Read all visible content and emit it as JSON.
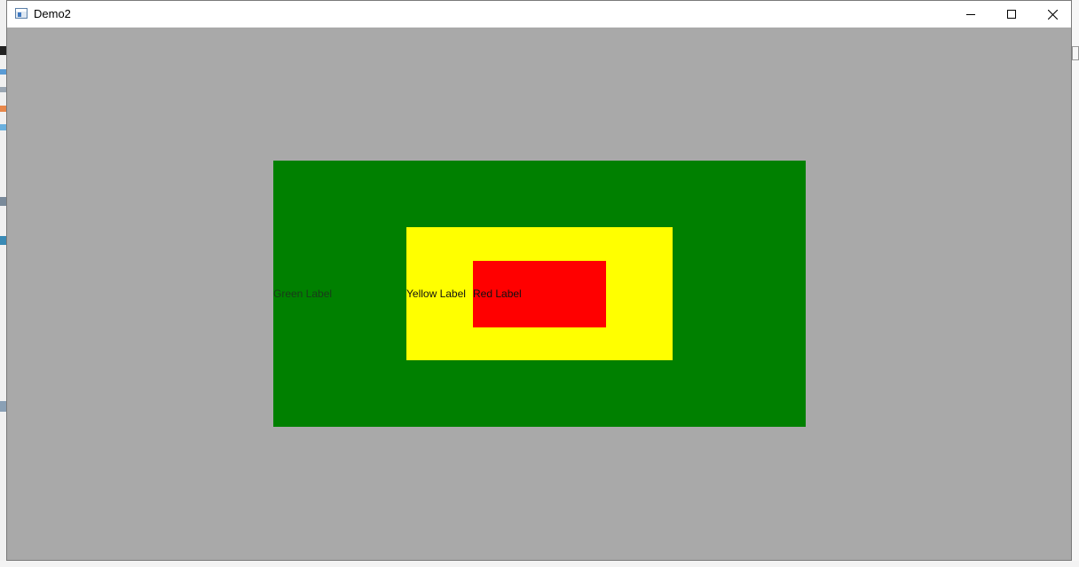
{
  "window": {
    "title": "Demo2",
    "background_color": "#a9a9a9"
  },
  "titlebar": {
    "icon": "app-window-icon",
    "minimize_icon": "minimize-icon",
    "maximize_icon": "maximize-icon",
    "close_icon": "close-icon"
  },
  "panels": {
    "green": {
      "label": "Green Label",
      "color": "#008000"
    },
    "yellow": {
      "label": "Yellow Label",
      "color": "#ffff00"
    },
    "red": {
      "label": "Red Label",
      "color": "#ff0000"
    }
  }
}
